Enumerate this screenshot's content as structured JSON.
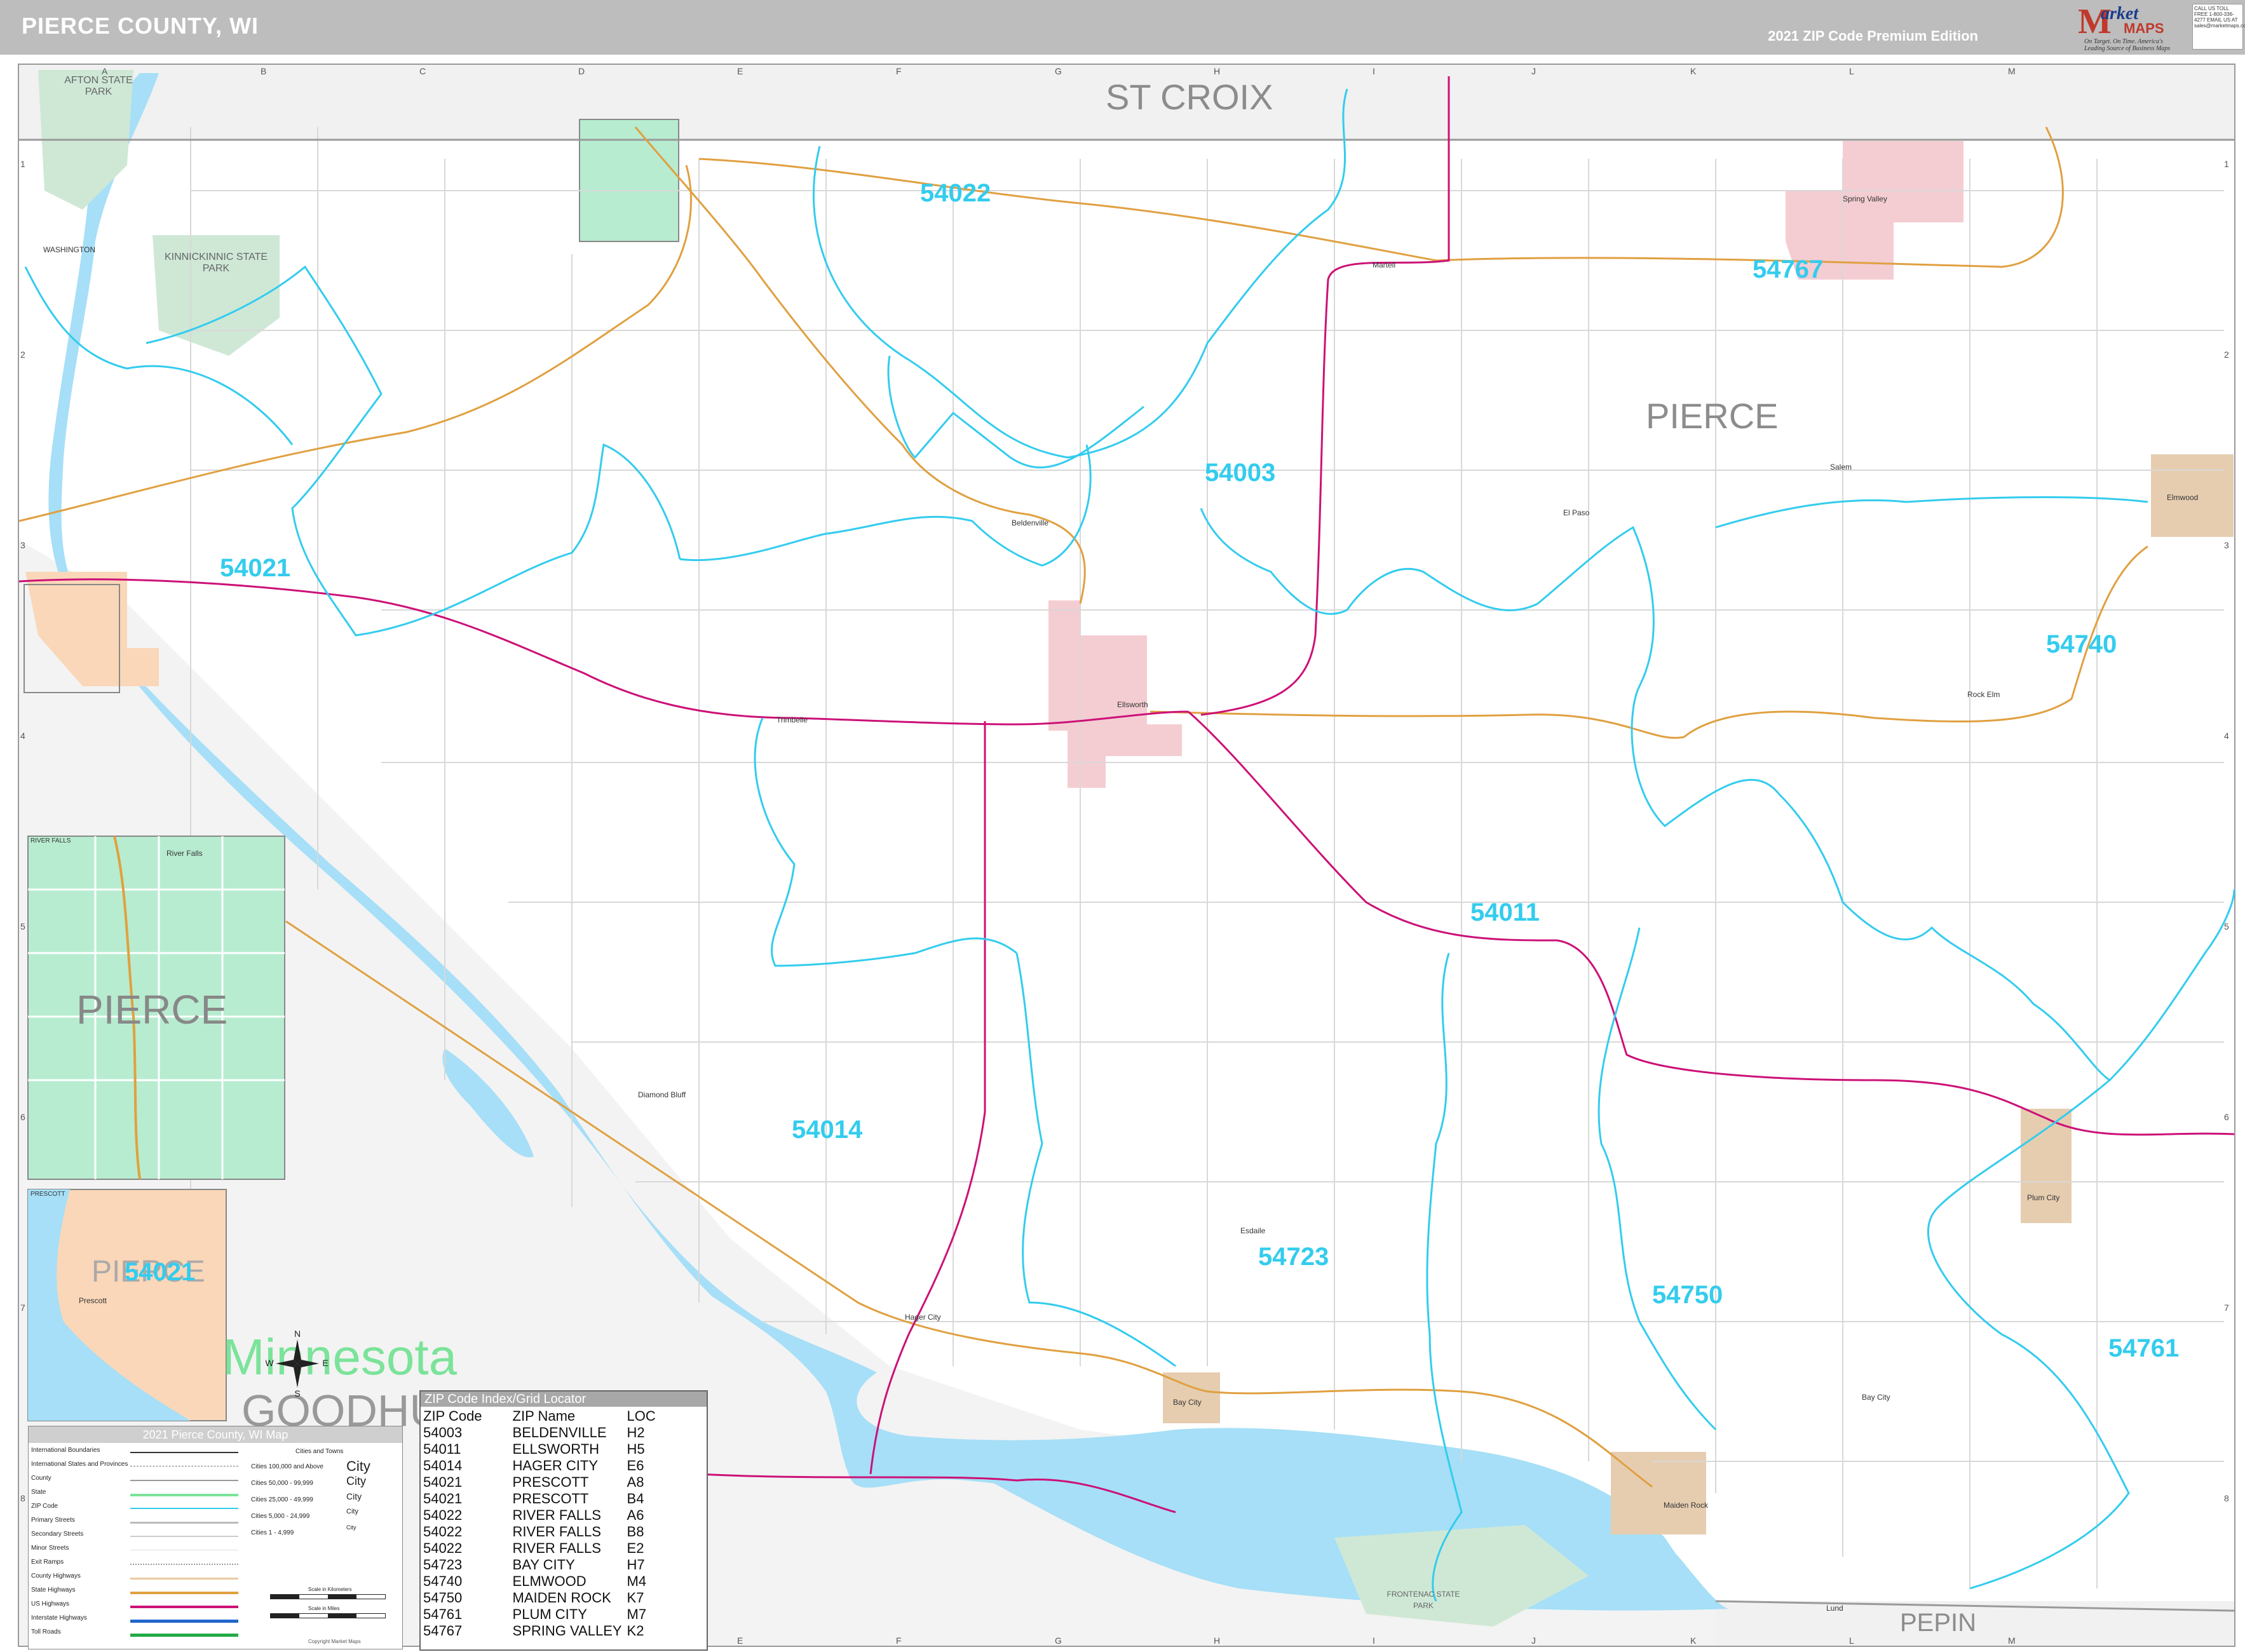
{
  "header": {
    "title": "PIERCE COUNTY, WI",
    "edition": "2021 ZIP Code Premium Edition"
  },
  "logo": {
    "m": "M",
    "name": "arket",
    "maps": "MAPS",
    "tagline": "On Target. On Time. America's Leading Source of Business Maps"
  },
  "contact": "CALL US TOLL FREE 1-800-336-4277 EMAIL US AT sales@marketmaps.com",
  "grid": {
    "columns": [
      "A",
      "B",
      "C",
      "D",
      "E",
      "F",
      "G",
      "H",
      "I",
      "J",
      "K",
      "L",
      "M"
    ],
    "rows": [
      "1",
      "2",
      "3",
      "4",
      "5",
      "6",
      "7",
      "8"
    ]
  },
  "counties": [
    "ST CROIX",
    "PIERCE",
    "PEPIN",
    "GOODHUE",
    "PIERCE",
    "PIERCE"
  ],
  "state": "Minnesota",
  "zip_labels": [
    "54022",
    "54767",
    "54003",
    "54021",
    "54740",
    "54011",
    "54014",
    "54723",
    "54750",
    "54761",
    "54021"
  ],
  "parks": [
    "AFTON STATE PARK",
    "KINNICKINNIC STATE PARK",
    "FRONTENAC STATE PARK"
  ],
  "places": [
    "River Falls",
    "Ellsworth",
    "Prescott",
    "Bay City",
    "Maiden Rock",
    "Plum City",
    "Spring Valley",
    "Elmwood",
    "Beldenville",
    "Hager City",
    "Diamond Bluff",
    "Esdaile",
    "Salem",
    "El Paso",
    "Martell",
    "Trimbelle",
    "Lund",
    "Bay City",
    "Rock Elm",
    "Ellsworth",
    "WASHINGTON"
  ],
  "insets": [
    {
      "title": "RIVER FALLS",
      "county": "PIERCE"
    },
    {
      "title": "PRESCOTT",
      "county": "PIERCE",
      "zip": "54021"
    }
  ],
  "legend": {
    "title": "2021 Pierce County, WI Map",
    "rows": [
      "International Boundaries",
      "International States and Provinces",
      "County",
      "State",
      "ZIP Code",
      "Primary Streets",
      "Secondary Streets",
      "Minor Streets",
      "Exit Ramps",
      "County Highways",
      "State Highways",
      "US Highways",
      "Interstate Highways",
      "Toll Roads"
    ],
    "city_header": "Cities and Towns",
    "city_rows": [
      {
        "range": "Cities 100,000 and Above",
        "sample": "City"
      },
      {
        "range": "Cities 50,000 - 99,999",
        "sample": "City"
      },
      {
        "range": "Cities 25,000 - 49,999",
        "sample": "City"
      },
      {
        "range": "Cities 5,000 - 24,999",
        "sample": "City"
      },
      {
        "range": "Cities 1 - 4,999",
        "sample": "City"
      }
    ],
    "scale_km": "Scale in Kilometers",
    "scale_mi": "Scale in Miles",
    "copyright": "Copyright Market Maps"
  },
  "zip_index": {
    "title": "ZIP Code Index/Grid Locator",
    "headers": [
      "ZIP Code",
      "ZIP Name",
      "LOC"
    ],
    "rows": [
      [
        "54003",
        "BELDENVILLE",
        "H2"
      ],
      [
        "54011",
        "ELLSWORTH",
        "H5"
      ],
      [
        "54014",
        "HAGER CITY",
        "E6"
      ],
      [
        "54021",
        "PRESCOTT",
        "A8"
      ],
      [
        "54021",
        "PRESCOTT",
        "B4"
      ],
      [
        "54022",
        "RIVER FALLS",
        "A6"
      ],
      [
        "54022",
        "RIVER FALLS",
        "B8"
      ],
      [
        "54022",
        "RIVER FALLS",
        "E2"
      ],
      [
        "54723",
        "BAY CITY",
        "H7"
      ],
      [
        "54740",
        "ELMWOOD",
        "M4"
      ],
      [
        "54750",
        "MAIDEN ROCK",
        "K7"
      ],
      [
        "54761",
        "PLUM CITY",
        "M7"
      ],
      [
        "54767",
        "SPRING VALLEY",
        "K2"
      ]
    ]
  },
  "colors": {
    "zip_boundary": "#33ccee",
    "water": "#a6dff7",
    "us_highway": "#cc1177",
    "state_highway": "#e0a040",
    "city_pink": "#f4cdd2",
    "city_tan": "#e6cdb0",
    "park_green": "#cfe8d6"
  }
}
